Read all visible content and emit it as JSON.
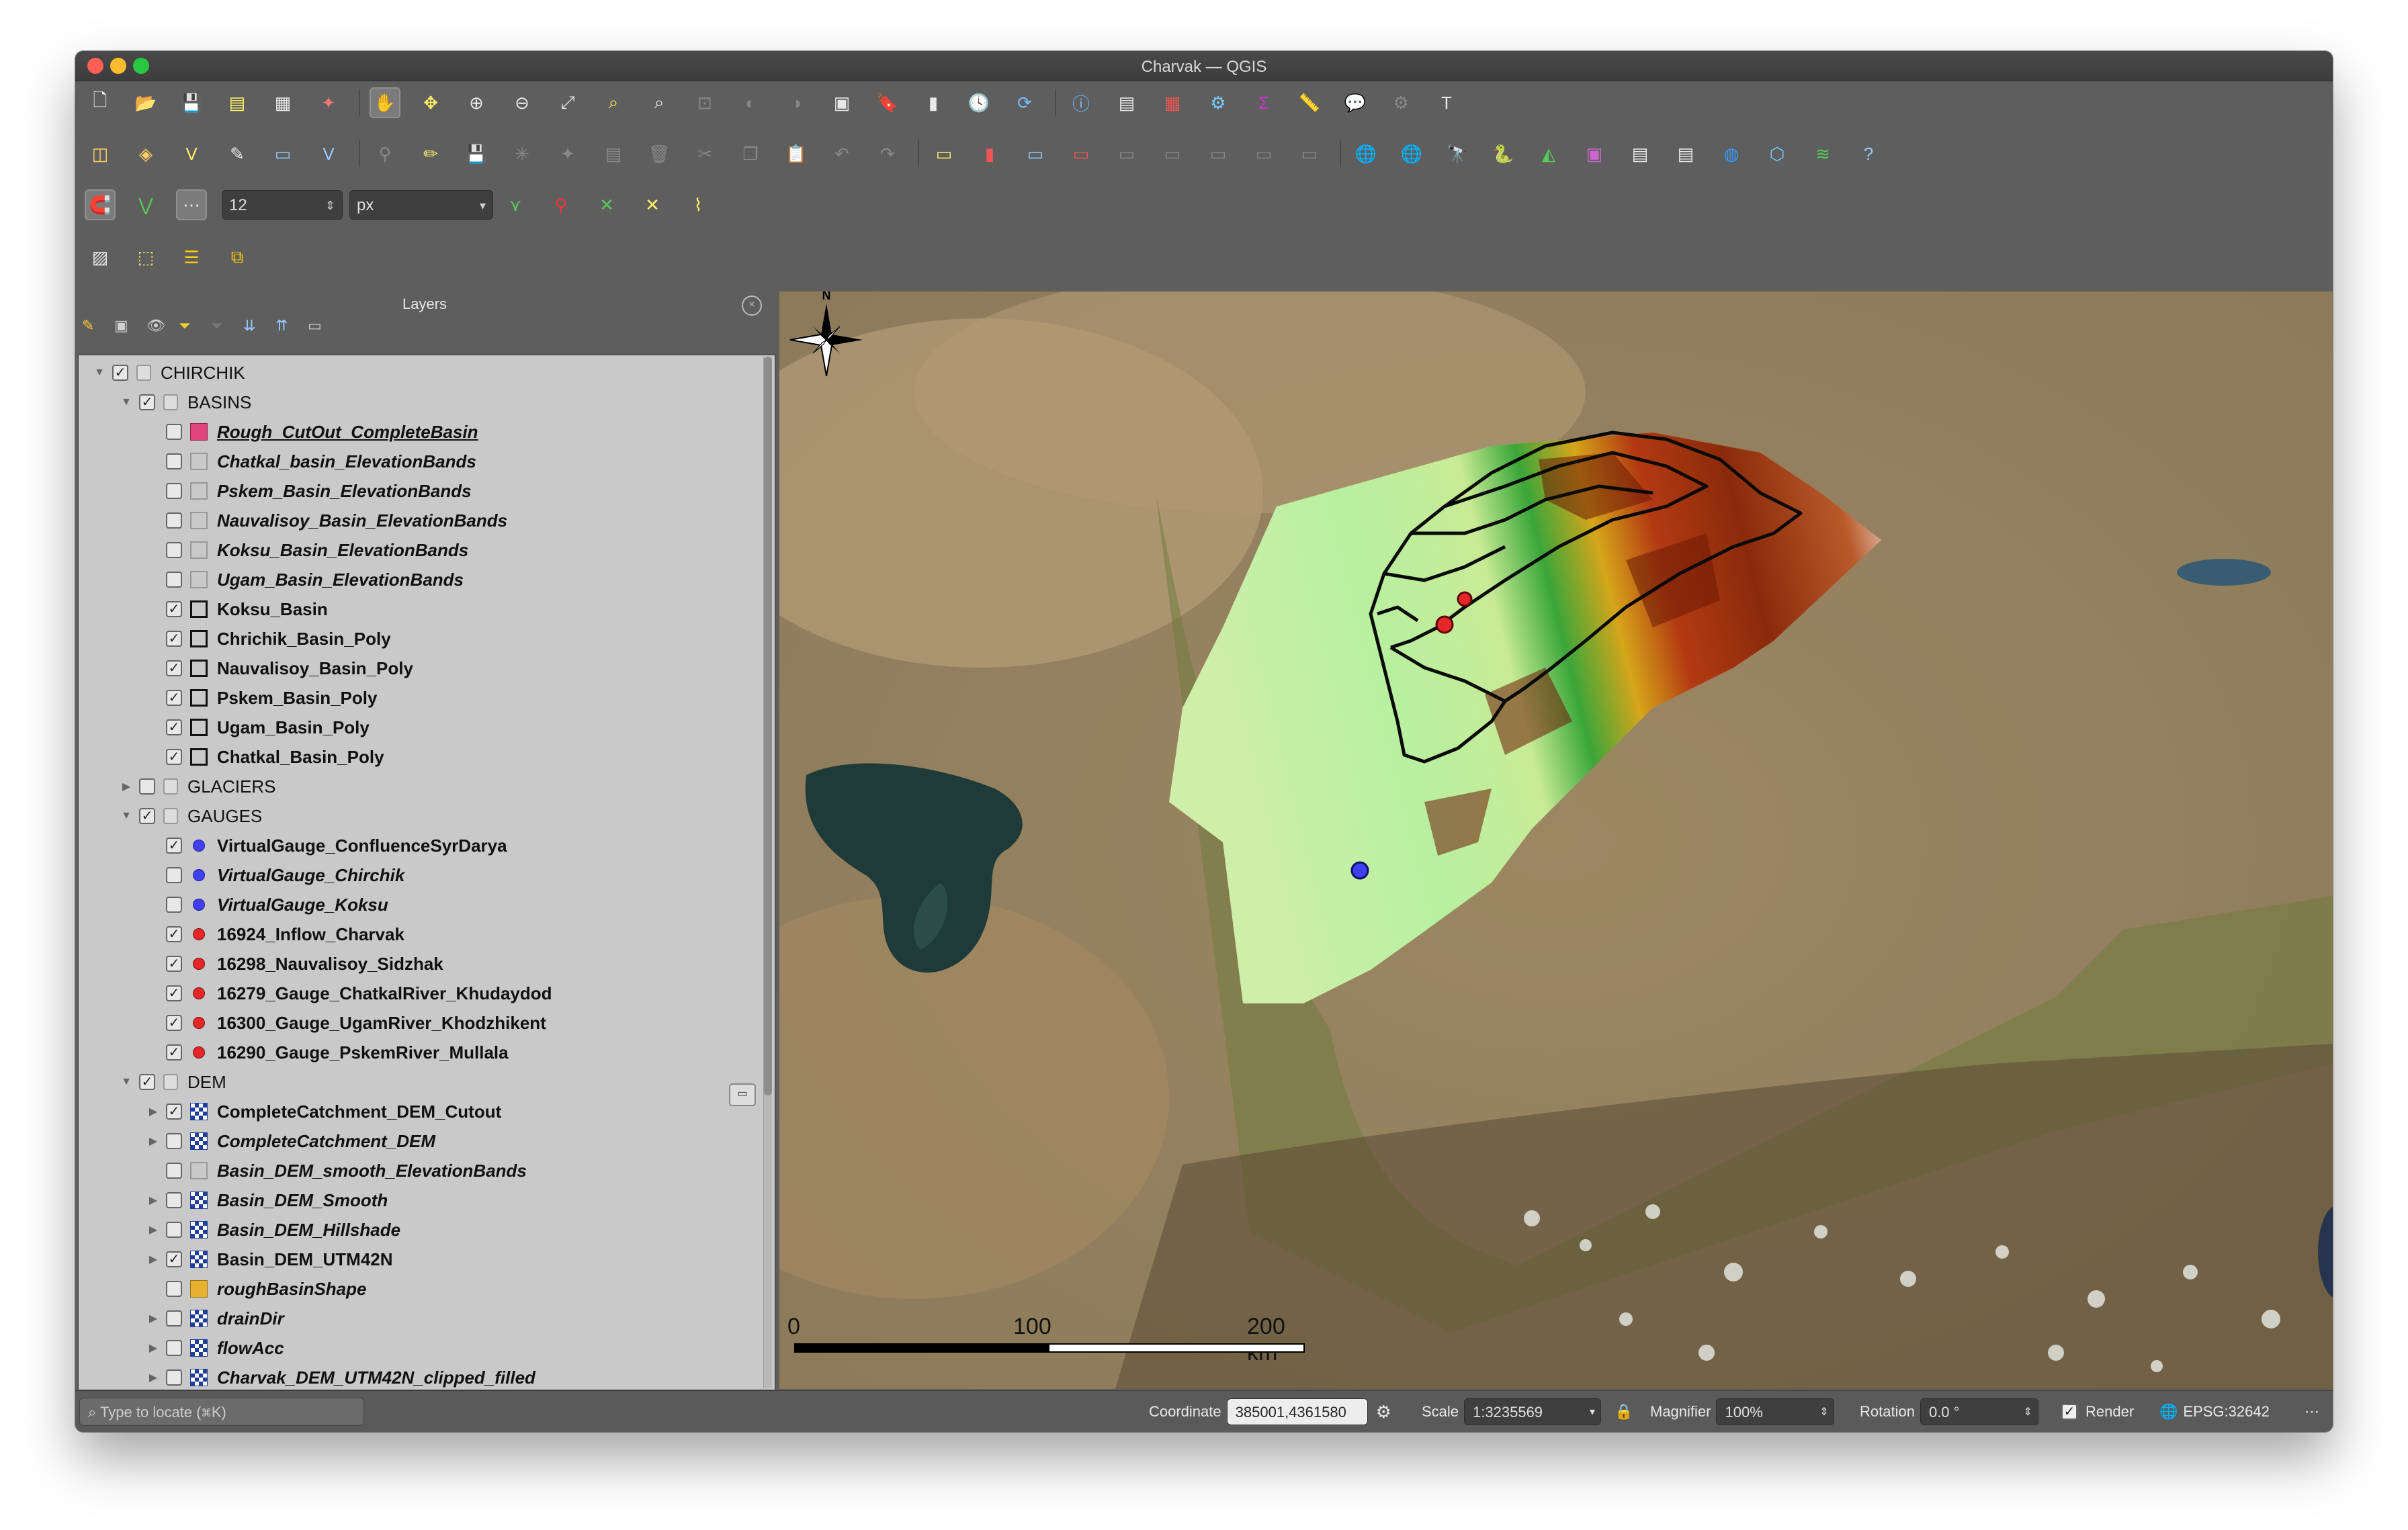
{
  "window": {
    "title": "Charvak — QGIS"
  },
  "toolbars": {
    "snap_tolerance_value": "12",
    "snap_unit": "px"
  },
  "layers_panel": {
    "title": "Layers",
    "tree": [
      {
        "label": "CHIRCHIK",
        "indent": 0,
        "expand": "open",
        "checked": true,
        "symbol": "group",
        "style": "normal"
      },
      {
        "label": "BASINS",
        "indent": 1,
        "expand": "open",
        "checked": true,
        "symbol": "group",
        "style": "normal"
      },
      {
        "label": "Rough_CutOut_CompleteBasin",
        "indent": 2,
        "expand": "none",
        "checked": false,
        "symbol": "fill-pink",
        "style": "italic-underline"
      },
      {
        "label": "Chatkal_basin_ElevationBands",
        "indent": 2,
        "expand": "none",
        "checked": false,
        "symbol": "empty-light",
        "style": "italic"
      },
      {
        "label": "Pskem_Basin_ElevationBands",
        "indent": 2,
        "expand": "none",
        "checked": false,
        "symbol": "empty-light",
        "style": "italic"
      },
      {
        "label": "Nauvalisoy_Basin_ElevationBands",
        "indent": 2,
        "expand": "none",
        "checked": false,
        "symbol": "empty-light",
        "style": "italic"
      },
      {
        "label": "Koksu_Basin_ElevationBands",
        "indent": 2,
        "expand": "none",
        "checked": false,
        "symbol": "empty-light",
        "style": "italic"
      },
      {
        "label": "Ugam_Basin_ElevationBands",
        "indent": 2,
        "expand": "none",
        "checked": false,
        "symbol": "empty-light",
        "style": "italic"
      },
      {
        "label": "Koksu_Basin",
        "indent": 2,
        "expand": "none",
        "checked": true,
        "symbol": "empty-black",
        "style": "bold"
      },
      {
        "label": "Chrichik_Basin_Poly",
        "indent": 2,
        "expand": "none",
        "checked": true,
        "symbol": "empty-black",
        "style": "bold"
      },
      {
        "label": "Nauvalisoy_Basin_Poly",
        "indent": 2,
        "expand": "none",
        "checked": true,
        "symbol": "empty-black",
        "style": "bold"
      },
      {
        "label": "Pskem_Basin_Poly",
        "indent": 2,
        "expand": "none",
        "checked": true,
        "symbol": "empty-black",
        "style": "bold"
      },
      {
        "label": "Ugam_Basin_Poly",
        "indent": 2,
        "expand": "none",
        "checked": true,
        "symbol": "empty-black",
        "style": "bold"
      },
      {
        "label": "Chatkal_Basin_Poly",
        "indent": 2,
        "expand": "none",
        "checked": true,
        "symbol": "empty-black",
        "style": "bold"
      },
      {
        "label": "GLACIERS",
        "indent": 1,
        "expand": "closed",
        "checked": false,
        "symbol": "group",
        "style": "normal"
      },
      {
        "label": "GAUGES",
        "indent": 1,
        "expand": "open",
        "checked": true,
        "symbol": "group",
        "style": "normal"
      },
      {
        "label": "VirtualGauge_ConfluenceSyrDarya",
        "indent": 2,
        "expand": "none",
        "checked": true,
        "symbol": "dot-blue",
        "style": "bold"
      },
      {
        "label": "VirtualGauge_Chirchik",
        "indent": 2,
        "expand": "none",
        "checked": false,
        "symbol": "dot-blue",
        "style": "italic"
      },
      {
        "label": "VirtualGauge_Koksu",
        "indent": 2,
        "expand": "none",
        "checked": false,
        "symbol": "dot-blue",
        "style": "italic"
      },
      {
        "label": "16924_Inflow_Charvak",
        "indent": 2,
        "expand": "none",
        "checked": true,
        "symbol": "dot-red",
        "style": "bold"
      },
      {
        "label": "16298_Nauvalisoy_Sidzhak",
        "indent": 2,
        "expand": "none",
        "checked": true,
        "symbol": "dot-red",
        "style": "bold"
      },
      {
        "label": "16279_Gauge_ChatkalRiver_Khudaydod",
        "indent": 2,
        "expand": "none",
        "checked": true,
        "symbol": "dot-red",
        "style": "bold"
      },
      {
        "label": "16300_Gauge_UgamRiver_Khodzhikent",
        "indent": 2,
        "expand": "none",
        "checked": true,
        "symbol": "dot-red",
        "style": "bold"
      },
      {
        "label": "16290_Gauge_PskemRiver_Mullala",
        "indent": 2,
        "expand": "none",
        "checked": true,
        "symbol": "dot-red",
        "style": "bold"
      },
      {
        "label": "DEM",
        "indent": 1,
        "expand": "open",
        "checked": true,
        "symbol": "group",
        "style": "normal"
      },
      {
        "label": "CompleteCatchment_DEM_Cutout",
        "indent": 2,
        "expand": "closed",
        "checked": true,
        "symbol": "raster",
        "style": "bold"
      },
      {
        "label": "CompleteCatchment_DEM",
        "indent": 2,
        "expand": "closed",
        "checked": false,
        "symbol": "raster",
        "style": "italic"
      },
      {
        "label": "Basin_DEM_smooth_ElevationBands",
        "indent": 2,
        "expand": "none",
        "checked": false,
        "symbol": "empty-light",
        "style": "italic"
      },
      {
        "label": "Basin_DEM_Smooth",
        "indent": 2,
        "expand": "closed",
        "checked": false,
        "symbol": "raster",
        "style": "italic"
      },
      {
        "label": "Basin_DEM_Hillshade",
        "indent": 2,
        "expand": "closed",
        "checked": false,
        "symbol": "raster",
        "style": "italic"
      },
      {
        "label": "Basin_DEM_UTM42N",
        "indent": 2,
        "expand": "closed",
        "checked": true,
        "symbol": "raster",
        "style": "bold"
      },
      {
        "label": "roughBasinShape",
        "indent": 2,
        "expand": "none",
        "checked": false,
        "symbol": "fill-yellow",
        "style": "italic"
      },
      {
        "label": "drainDir",
        "indent": 2,
        "expand": "closed",
        "checked": false,
        "symbol": "raster",
        "style": "italic"
      },
      {
        "label": "flowAcc",
        "indent": 2,
        "expand": "closed",
        "checked": false,
        "symbol": "raster",
        "style": "italic"
      },
      {
        "label": "Charvak_DEM_UTM42N_clipped_filled",
        "indent": 2,
        "expand": "closed",
        "checked": false,
        "symbol": "raster",
        "style": "italic"
      }
    ]
  },
  "map": {
    "north_arrow_label": "N",
    "scalebar": {
      "labels": [
        "0",
        "100",
        "200 km"
      ]
    }
  },
  "statusbar": {
    "locate_placeholder": "Type to locate (⌘K)",
    "coordinate_label": "Coordinate",
    "coordinate_value": "385001,4361580",
    "scale_label": "Scale",
    "scale_value": "1:3235569",
    "magnifier_label": "Magnifier",
    "magnifier_value": "100%",
    "rotation_label": "Rotation",
    "rotation_value": "0.0 °",
    "render_label": "Render",
    "render_checked": true,
    "crs_label": "EPSG:32642"
  }
}
